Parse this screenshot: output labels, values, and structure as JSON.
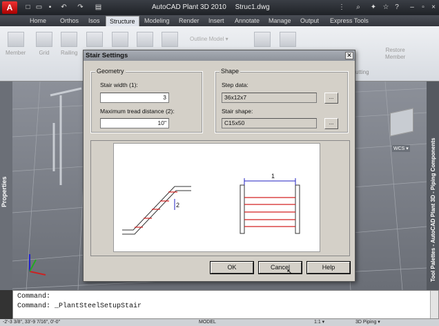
{
  "titlebar": {
    "app_logo": "A",
    "app_name": "AutoCAD Plant 3D 2010",
    "file_name": "Struc1.dwg",
    "colors": {
      "bar": "#2a2d33",
      "logo": "#cc2222"
    }
  },
  "tabs": [
    "Home",
    "Orthos",
    "Isos",
    "Structure",
    "Modeling",
    "Render",
    "Insert",
    "Annotate",
    "Manage",
    "Output",
    "Express Tools"
  ],
  "active_tab": "Structure",
  "ribbon": {
    "buttons": [
      "Member",
      "Grid",
      "Railing"
    ],
    "outline_model": "Outline Model ▾",
    "restore_member": "Restore\nMember",
    "cutting_panel": "utting"
  },
  "palettes": {
    "properties": "Properties",
    "tool_palettes": "Tool Palettes - AutoCAD Plant 3D - Piping Components",
    "wcs": "WCS ▾"
  },
  "dialog": {
    "title": "Stair Settings",
    "close": "✕",
    "geometry": {
      "legend": "Geometry",
      "stair_width_label": "Stair width (1):",
      "stair_width_value": "3",
      "max_tread_label": "Maximum tread distance (2):",
      "max_tread_value": "10\""
    },
    "shape": {
      "legend": "Shape",
      "step_data_label": "Step data:",
      "step_data_value": "36x12x7",
      "stair_shape_label": "Stair shape:",
      "stair_shape_value": "C15x50",
      "browse": "..."
    },
    "preview": {
      "label_1": "1",
      "label_2": "2",
      "line_color": "#d42020",
      "dim_color": "#2020c0"
    },
    "buttons": {
      "ok": "OK",
      "cancel": "Cancel",
      "help": "Help"
    }
  },
  "command_line": [
    "Command:",
    "Command: _PlantSteelSetupStair"
  ],
  "status": {
    "coords": "-2'-3 3/8\", 33'-9 7/16\", 0'-0\"",
    "model": "MODEL",
    "scale": "1:1 ▾",
    "workspace": "3D Piping ▾"
  }
}
